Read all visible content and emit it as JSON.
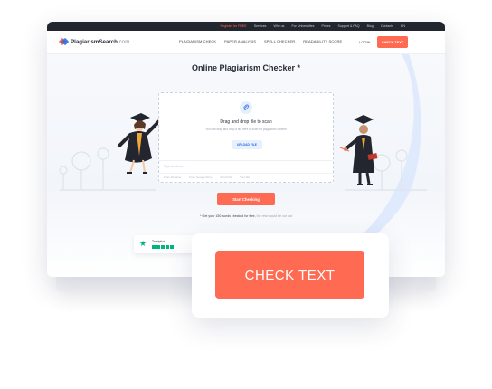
{
  "topbar": {
    "links": [
      "Register for FREE",
      "Services",
      "Why us",
      "For Universities",
      "Prices",
      "Support & FAQ",
      "Blog",
      "Contacts",
      "EN"
    ]
  },
  "brand": {
    "name_bold": "Plagiarism",
    "name_rest": "Search",
    "domain": ".com",
    "accent": "#ff6a52",
    "blue": "#2d6be4"
  },
  "nav": {
    "links": [
      "PLAGIARISM CHECK",
      "PAPER ANALYSIS",
      "SPELL CHECKER",
      "READABILITY SCORE"
    ],
    "login": "LOGIN",
    "cta": "CHECK TEXT"
  },
  "hero": {
    "title": "Online Plagiarism Checker *",
    "drop_title": "Drag and drop file to scan",
    "drop_subtitle": "You can drag and drop a file here to scan for plagiarism content",
    "upload_label": "UPLOAD FILE",
    "text_placeholder": "Type text here...",
    "options": [
      "From Dropbox",
      "From Google Drive",
      "Word File",
      "Via URL"
    ],
    "start_label": "Start Checking",
    "note_main": "* Get your 150 words checked for free,",
    "note_muted": " the rest would be cut out"
  },
  "trustpilot": {
    "name": "Trustpilot",
    "stars": 5
  },
  "overlay": {
    "button_label": "CHECK TEXT"
  }
}
